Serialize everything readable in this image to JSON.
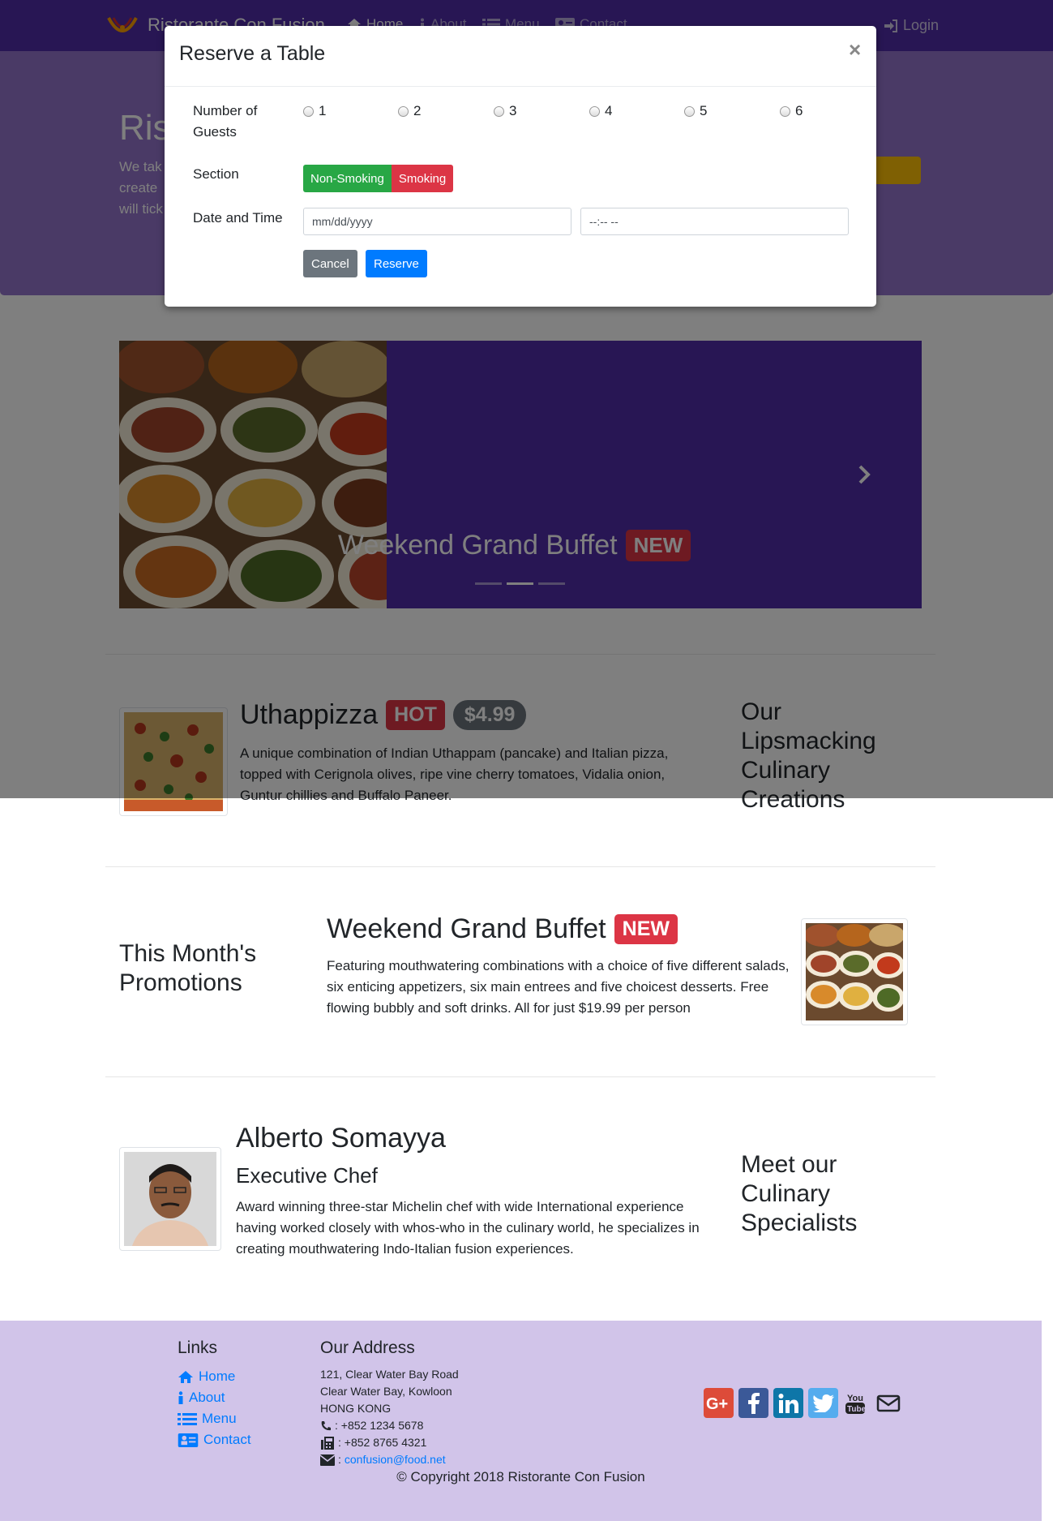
{
  "navbar": {
    "brand": "Ristorante Con Fusion",
    "items": [
      {
        "label": "Home",
        "icon": "home-icon"
      },
      {
        "label": "About",
        "icon": "info-icon"
      },
      {
        "label": "Menu",
        "icon": "list-icon"
      },
      {
        "label": "Contact",
        "icon": "address-card-icon"
      }
    ],
    "login": "Login"
  },
  "jumbotron": {
    "title": "Ris",
    "text_lines": [
      "We tak",
      "create",
      "will tick"
    ]
  },
  "carousel": {
    "caption": "Weekend Grand Buffet",
    "badge": "NEW",
    "slides": 3,
    "active_slide": 2
  },
  "dish": {
    "name": "Uthappizza",
    "label": "HOT",
    "price": "$4.99",
    "description": "A unique combination of Indian Uthappam (pancake) and Italian pizza, topped with Cerignola olives, ripe vine cherry tomatoes, Vidalia onion, Guntur chillies and Buffalo Paneer.",
    "section_heading": "Our Lipsmacking Culinary Creations"
  },
  "promotion": {
    "section_heading": "This Month's Promotions",
    "name": "Weekend Grand Buffet",
    "label": "NEW",
    "description": "Featuring mouthwatering combinations with a choice of five different salads, six enticing appetizers, six main entrees and five choicest desserts. Free flowing bubbly and soft drinks. All for just $19.99 per person"
  },
  "leader": {
    "name": "Alberto Somayya",
    "designation": "Executive Chef",
    "description": "Award winning three-star Michelin chef with wide International experience having worked closely with whos-who in the culinary world, he specializes in creating mouthwatering Indo-Italian fusion experiences.",
    "section_heading": "Meet our Culinary Specialists"
  },
  "footer": {
    "links_heading": "Links",
    "links": [
      "Home",
      "About",
      "Menu",
      "Contact"
    ],
    "address_heading": "Our Address",
    "address_lines": [
      "121, Clear Water Bay Road",
      "Clear Water Bay, Kowloon",
      "HONG KONG"
    ],
    "phone": ": +852 1234 5678",
    "fax": ": +852 8765 4321",
    "email_prefix": ":",
    "email": "confusion@food.net",
    "social_icons": [
      "google-plus-icon",
      "facebook-icon",
      "linkedin-icon",
      "twitter-icon",
      "youtube-icon",
      "envelope-icon"
    ],
    "copyright": "© Copyright 2018 Ristorante Con Fusion"
  },
  "modal": {
    "title": "Reserve a Table",
    "close": "×",
    "guests_label_line1": "Number of",
    "guests_label_line2": "Guests",
    "guest_options": [
      "1",
      "2",
      "3",
      "4",
      "5",
      "6"
    ],
    "section_label": "Section",
    "section_options": [
      "Non-Smoking",
      "Smoking"
    ],
    "datetime_label": "Date and Time",
    "date_placeholder": "mm/dd/yyyy",
    "time_placeholder": "--:-- --",
    "cancel": "Cancel",
    "reserve": "Reserve"
  },
  "colors": {
    "primary": "#512da8",
    "primary_light": "#9575cd",
    "footer_bg": "#d1c4e9",
    "danger": "#dc3545",
    "success": "#28a745",
    "link": "#007bff"
  }
}
